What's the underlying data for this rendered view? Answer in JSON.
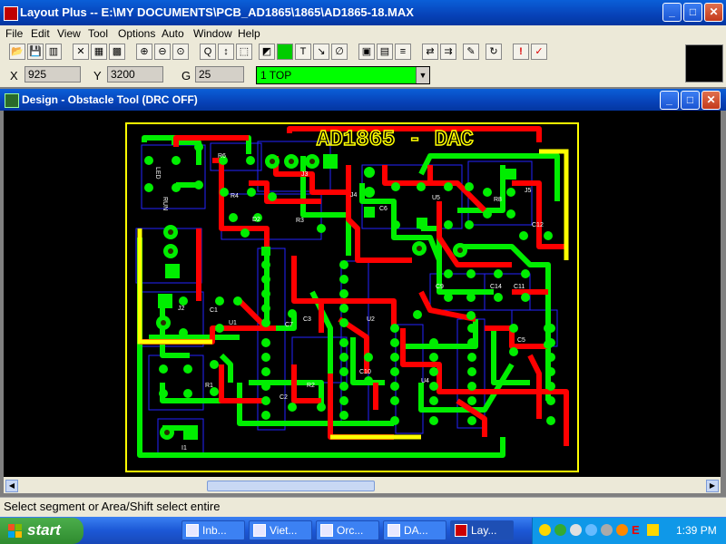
{
  "app": {
    "title": "Layout Plus -- E:\\MY DOCUMENTS\\PCB_AD1865\\1865\\AD1865-18.MAX",
    "min": "_",
    "max": "□",
    "close": "✕"
  },
  "menu": [
    "File",
    "Edit",
    "View",
    "Tool",
    "Options",
    "Auto",
    "Window",
    "Help"
  ],
  "toolbar": {
    "icons": [
      "open-icon",
      "save-icon",
      "library-icon",
      "close-icon",
      "spreadsheet-icon",
      "grid-icon",
      "zoom-in-icon",
      "zoom-out-icon",
      "zoom-all-icon",
      "query-icon",
      "pin-icon",
      "component-icon",
      "obstacle-icon",
      "text-icon",
      "connection-icon",
      "error-icon",
      "color-icon",
      "drc-icon",
      "layers-icon",
      "reconnect-icon",
      "shove-icon",
      "edit-icon",
      "refresh-icon",
      "warning-icon",
      "drc-check-icon"
    ],
    "glyphs": [
      "📂",
      "💾",
      "▥",
      "✕",
      "▦",
      "▩",
      "⊕",
      "⊖",
      "⊙",
      "Q",
      "↕",
      "⬚",
      "◩",
      "T",
      "↘",
      "∅",
      "▣",
      "▤",
      "≡",
      "⇄",
      "⇉",
      "✎",
      "↻",
      "!",
      "✓"
    ]
  },
  "coords": {
    "x_label": "X",
    "x_value": "925",
    "y_label": "Y",
    "y_value": "3200",
    "g_label": "G",
    "g_value": "25",
    "layer": "1 TOP",
    "layer_dropdown": "▼"
  },
  "document": {
    "title": "Design - Obstacle Tool (DRC OFF)",
    "min": "_",
    "max": "□",
    "close": "✕"
  },
  "pcb": {
    "board_label": "AD1865 - DAC",
    "ref_labels": [
      "R6",
      "R4",
      "R3",
      "D2",
      "LED",
      "RUN",
      "J3",
      "J4",
      "C6",
      "U5",
      "R8",
      "J5",
      "C12",
      "C9",
      "C1",
      "U1",
      "C7",
      "C14",
      "C11",
      "J2",
      "C3",
      "U2",
      "U4",
      "C10",
      "R1",
      "R2",
      "C5",
      "C2",
      "I1"
    ],
    "colors": {
      "top": "#ff0000",
      "bottom": "#00ee00",
      "pad": "#00ee00",
      "outline": "#ffff00",
      "background": "#000000",
      "silk": "#1a1aff"
    }
  },
  "status": "Select segment or Area/Shift select entire",
  "taskbar": {
    "start": "start",
    "tasks": [
      "Inb...",
      "Viet...",
      "Orc...",
      "DA...",
      "Lay..."
    ],
    "clock": "1:39 PM"
  }
}
